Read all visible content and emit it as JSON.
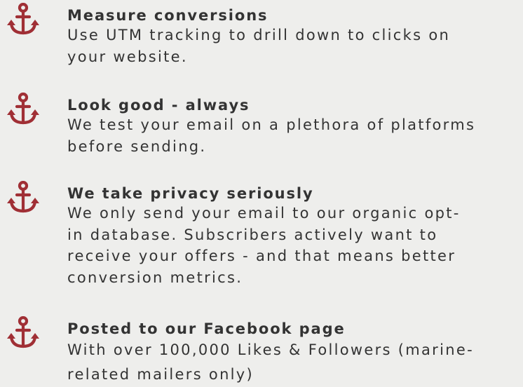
{
  "colors": {
    "background": "#eeeeec",
    "text": "#333333",
    "icon": "#a02f35"
  },
  "features": [
    {
      "icon": "anchor-icon",
      "title": "Measure conversions",
      "lines": [
        "Use UTM tracking to drill down to clicks on",
        "your website."
      ]
    },
    {
      "icon": "anchor-icon",
      "title": "Look good - always",
      "lines": [
        "We test your email on a plethora of platforms",
        "before sending."
      ]
    },
    {
      "icon": "anchor-icon",
      "title": "We take privacy seriously",
      "lines": [
        "We only send your email to our organic opt-",
        "in database. Subscribers actively want to",
        "receive your offers - and that means better",
        "conversion metrics."
      ]
    },
    {
      "icon": "anchor-icon",
      "title": "Posted to our Facebook page",
      "lines": [
        "With over 100,000 Likes & Followers (marine-",
        "related mailers only)"
      ]
    }
  ]
}
